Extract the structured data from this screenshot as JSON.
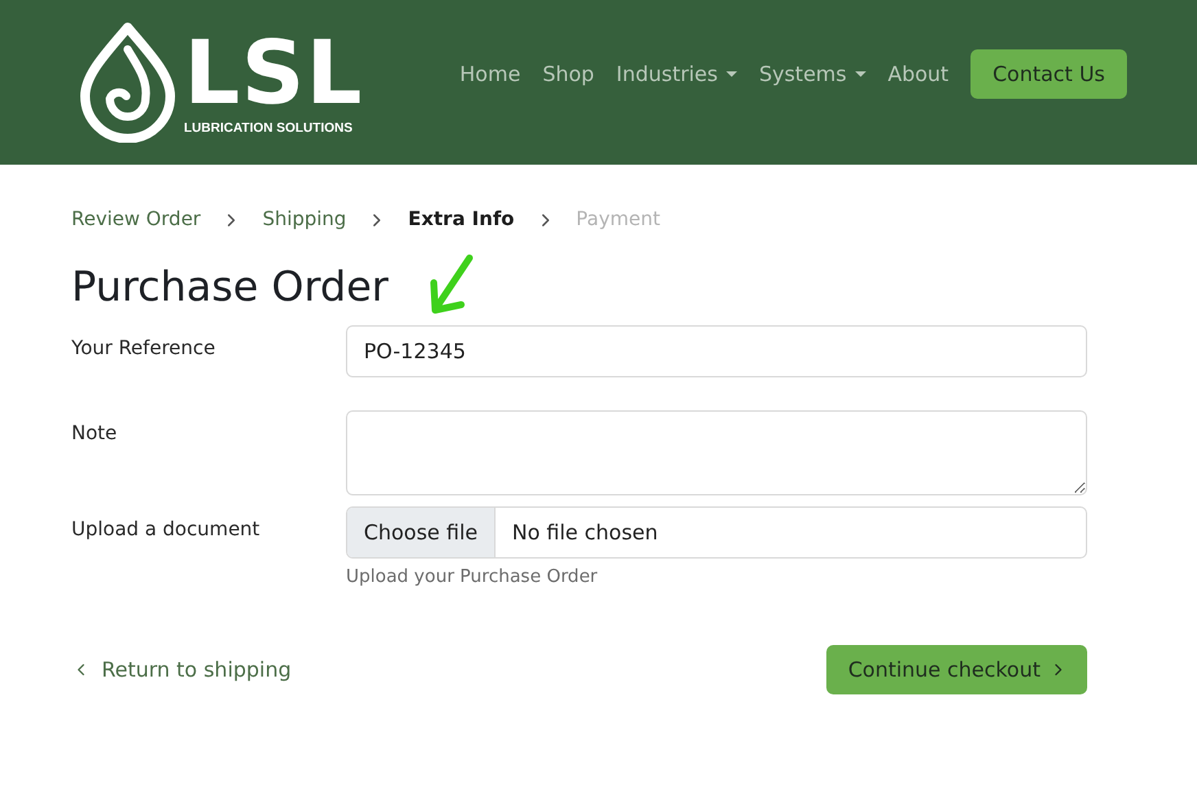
{
  "logo": {
    "title": "LSL",
    "subtitle": "LUBRICATION SOLUTIONS"
  },
  "nav": [
    {
      "label": "Home",
      "dropdown": false
    },
    {
      "label": "Shop",
      "dropdown": false
    },
    {
      "label": "Industries",
      "dropdown": true
    },
    {
      "label": "Systems",
      "dropdown": true
    },
    {
      "label": "About",
      "dropdown": false
    }
  ],
  "contact_button": "Contact Us",
  "steps": [
    {
      "label": "Review Order",
      "kind": "done"
    },
    {
      "label": "Shipping",
      "kind": "done"
    },
    {
      "label": "Extra Info",
      "kind": "current"
    },
    {
      "label": "Payment",
      "kind": "upcoming"
    }
  ],
  "heading": "Purchase Order",
  "reference": {
    "label": "Your Reference",
    "value": "PO-12345"
  },
  "note": {
    "label": "Note"
  },
  "upload": {
    "label": "Upload a document",
    "button": "Choose file",
    "status": "No file chosen",
    "help": "Upload your Purchase Order"
  },
  "back_link": "Return to shipping",
  "continue_button": "Continue checkout"
}
